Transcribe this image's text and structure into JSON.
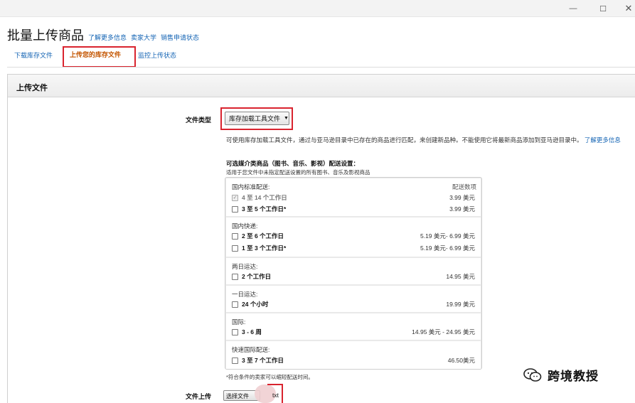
{
  "window": {
    "minimize_glyph": "—",
    "maximize_glyph": "☐",
    "close_glyph": "✕"
  },
  "header": {
    "title": "批量上传商品",
    "links": [
      "了解更多信息",
      "卖家大学",
      "销售申请状态"
    ]
  },
  "tabs": [
    {
      "label": "下载库存文件"
    },
    {
      "label": "上传您的库存文件",
      "active": true
    },
    {
      "label": "监控上传状态"
    }
  ],
  "panel": {
    "title": "上传文件",
    "file_type_label": "文件类型",
    "file_type_selected": "库存加载工具文件",
    "description": "可使用库存加载工具文件，通过与亚马逊目录中已存在的商品进行匹配，来创建新品种。不能使用它将最新商品添加到亚马逊目录中。",
    "description_link": "了解更多信息",
    "media_title": "可选媒介类商品（图书、音乐、影视）配送设置：",
    "media_subtitle": "适用于您文件中未指定配送设置的所有图书、音乐及影视商品",
    "fee_header": "配送数项",
    "shipping_groups": [
      {
        "name": "国内标准配送:",
        "options": [
          {
            "label": "4 至 14 个工作日",
            "price": "3.99 美元",
            "checked": true,
            "disabled": true
          },
          {
            "label": "3 至 5 个工作日*",
            "price": "3.99 美元",
            "checked": false
          }
        ]
      },
      {
        "name": "国内快递:",
        "options": [
          {
            "label": "2 至 6 个工作日",
            "price": "5.19 美元- 6.99 美元",
            "checked": false
          },
          {
            "label": "1 至 3 个工作日*",
            "price": "5.19 美元- 6.99 美元",
            "checked": false
          }
        ]
      },
      {
        "name": "两日运达:",
        "options": [
          {
            "label": "2 个工作日",
            "price": "14.95 美元",
            "checked": false
          }
        ]
      },
      {
        "name": "一日运达:",
        "options": [
          {
            "label": "24 个小时",
            "price": "19.99 美元",
            "checked": false
          }
        ]
      },
      {
        "name": "国际:",
        "options": [
          {
            "label": "3 - 6 周",
            "price": "14.95 美元 - 24.95 美元",
            "checked": false
          }
        ]
      },
      {
        "name": "快速国际配送:",
        "options": [
          {
            "label": "3 至 7 个工作日",
            "price": "46.50美元",
            "checked": false
          }
        ]
      }
    ],
    "footnote": "*符合条件的卖家可以缩短配送时间。",
    "file_upload_label": "文件上传",
    "choose_file_button": "选择文件",
    "file_name_visible": "txt"
  },
  "watermark": {
    "text": "跨境教授"
  },
  "colors": {
    "link": "#1464b4",
    "active_tab": "#c45500",
    "highlight_box": "#d9232e"
  }
}
